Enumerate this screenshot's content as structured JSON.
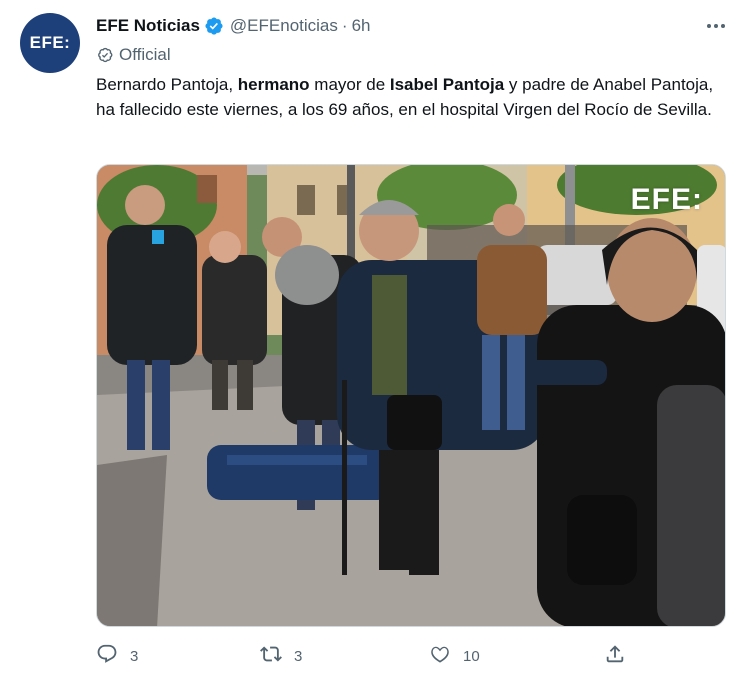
{
  "account": {
    "avatar_text": "EFE:",
    "name": "EFE Noticias",
    "handle": "@EFEnoticias",
    "separator": "·",
    "time": "6h",
    "official_label": "Official"
  },
  "tweet": {
    "t1": "Bernardo Pantoja, ",
    "b1": "hermano",
    "t2": " mayor de ",
    "b2": "Isabel Pantoja",
    "t3": " y padre de Anabel Pantoja, ha fallecido este viernes, a los  69 años, en el hospital Virgen del Rocío de Sevilla."
  },
  "media": {
    "watermark": "EFE:"
  },
  "actions": {
    "reply_count": "3",
    "retweet_count": "3",
    "like_count": "10"
  },
  "icons": {
    "verified": "verified-badge-icon",
    "official": "official-badge-icon",
    "more": "more-options-icon",
    "reply": "reply-icon",
    "retweet": "retweet-icon",
    "like": "heart-icon",
    "share": "share-icon"
  },
  "colors": {
    "verified": "#1d9bf0",
    "avatar_bg": "#1d3f7a",
    "secondary_text": "#536471"
  }
}
